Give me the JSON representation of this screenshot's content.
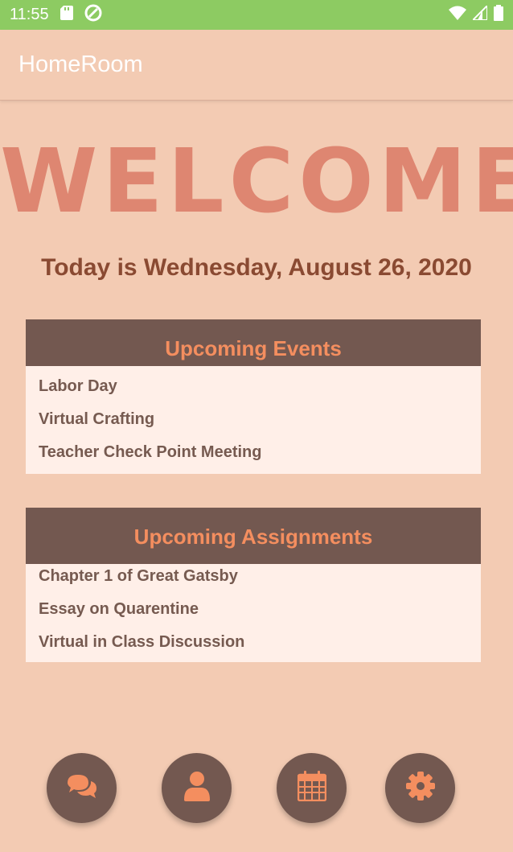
{
  "status_bar": {
    "time": "11:55",
    "icons": [
      "sd-card-icon",
      "sync-icon",
      "wifi-icon",
      "signal-icon",
      "battery-icon"
    ]
  },
  "app_bar": {
    "title": "HomeRoom"
  },
  "welcome": {
    "text": "WELCOME"
  },
  "today": {
    "text": "Today is Wednesday, August 26, 2020"
  },
  "events": {
    "title": "Upcoming Events",
    "items": [
      "Labor Day",
      "Virtual Crafting",
      "Teacher Check Point Meeting"
    ]
  },
  "assignments": {
    "title": "Upcoming Assignments",
    "items": [
      "Chapter 1 of Great Gatsby",
      "Essay on Quarentine",
      "Virtual in Class Discussion"
    ]
  },
  "nav_buttons": [
    {
      "icon": "chat-bubbles-icon"
    },
    {
      "icon": "person-icon"
    },
    {
      "icon": "calendar-icon"
    },
    {
      "icon": "gear-icon"
    }
  ],
  "colors": {
    "status_bar": "#8DCB62",
    "background": "#F3CBB3",
    "welcome": "#DE8671",
    "date_text": "#8A4A32",
    "card_header": "#735850",
    "card_header_text": "#F48E5F",
    "card_body": "#FFEFE8",
    "item_text": "#765A50",
    "fab": "#735850",
    "fab_icon": "#F48E5F"
  }
}
